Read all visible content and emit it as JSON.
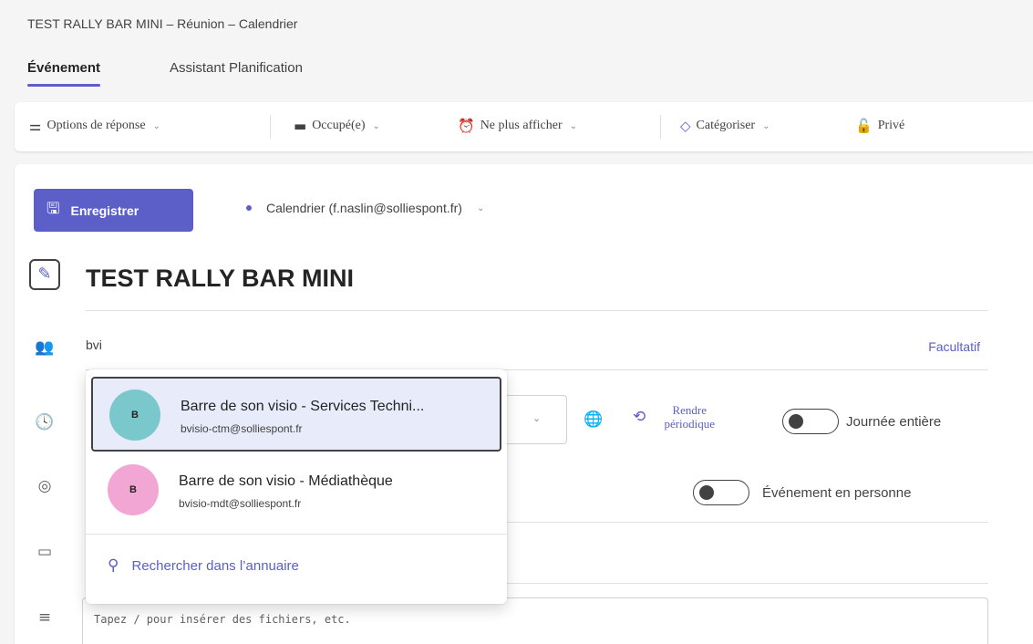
{
  "window": {
    "title": "TEST RALLY BAR MINI – Réunion – Calendrier"
  },
  "tabs": [
    {
      "label": "Événement",
      "active": true
    },
    {
      "label": "Assistant Planification",
      "active": false
    }
  ],
  "toolbar": {
    "response_options": "Options de réponse",
    "busy": "Occupé(e)",
    "remind": "Ne plus afficher",
    "categorize": "Catégoriser",
    "private": "Privé"
  },
  "save_label": "Enregistrer",
  "calendar": "Calendrier (f.naslin@solliespont.fr)",
  "event_title": "TEST RALLY BAR MINI",
  "attendees": {
    "value": "bvi",
    "optional_label": "Facultatif"
  },
  "time_row": {
    "recurrence_label": "Rendre périodique",
    "all_day_label": "Journée entière"
  },
  "location_row": {
    "in_person_label": "Événement en personne"
  },
  "description": {
    "placeholder": "Tapez / pour insérer des fichiers, etc."
  },
  "suggestions": [
    {
      "initial": "B",
      "name": "Barre de son visio - Services Techni...",
      "email": "bvisio-ctm@solliespont.fr",
      "color": "#7ac7cc",
      "selected": true
    },
    {
      "initial": "B",
      "name": "Barre de son visio - Médiathèque",
      "email": "bvisio-mdt@solliespont.fr",
      "color": "#f2a6d4",
      "selected": false
    }
  ],
  "directory_search": "Rechercher dans l’annuaire",
  "colors": {
    "accent": "#5b5fc7",
    "selected_bg": "#e8ebfa"
  }
}
